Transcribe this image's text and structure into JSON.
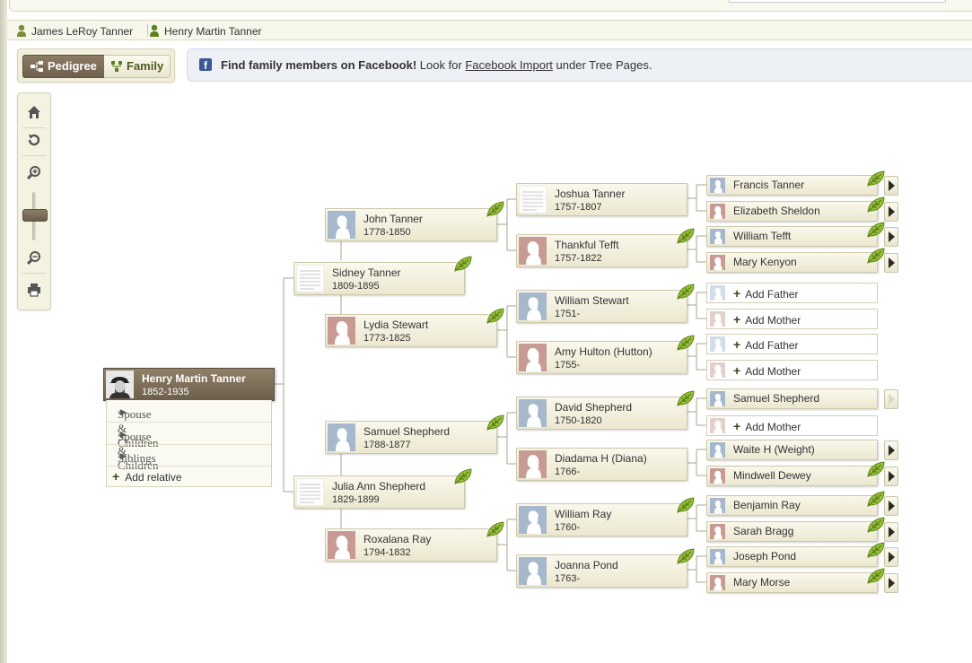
{
  "breadcrumbs": [
    {
      "label": "James LeRoy Tanner"
    },
    {
      "label": "Henry Martin Tanner"
    }
  ],
  "view_toggle": {
    "pedigree": "Pedigree",
    "family": "Family"
  },
  "facebook_bar": {
    "bold": "Find family members on Facebook!",
    "pre": " Look for ",
    "link": "Facebook Import",
    "post": " under Tree Pages."
  },
  "root_person": {
    "name": "Henry Martin Tanner",
    "dates": "1852-1935"
  },
  "root_menu": {
    "item1": "Spouse & Children",
    "item2": "Spouse & Children",
    "item3": "Siblings",
    "add": "Add relative"
  },
  "gen1": {
    "father": {
      "name": "Sidney Tanner",
      "dates": "1809-1895"
    },
    "mother": {
      "name": "Julia Ann Shepherd",
      "dates": "1829-1899"
    }
  },
  "gen2": {
    "ff": {
      "name": "John Tanner",
      "dates": "1778-1850"
    },
    "fm": {
      "name": "Lydia Stewart",
      "dates": "1773-1825"
    },
    "mf": {
      "name": "Samuel Shepherd",
      "dates": "1788-1877"
    },
    "mm": {
      "name": "Roxalana Ray",
      "dates": "1794-1832"
    }
  },
  "gen3": {
    "fff": {
      "name": "Joshua Tanner",
      "dates": "1757-1807"
    },
    "ffm": {
      "name": "Thankful Tefft",
      "dates": "1757-1822"
    },
    "fmf": {
      "name": "William Stewart",
      "dates": "1751-"
    },
    "fmm": {
      "name": "Amy Hulton (Hutton)",
      "dates": "1755-"
    },
    "mff": {
      "name": "David Shepherd",
      "dates": "1750-1820"
    },
    "mfm": {
      "name": "Diadama H (Diana)",
      "dates": "1766-"
    },
    "mmf": {
      "name": "William Ray",
      "dates": "1760-"
    },
    "mmm": {
      "name": "Joanna Pond",
      "dates": "1763-"
    }
  },
  "gen4": {
    "p1": "Francis Tanner",
    "p2": "Elizabeth Sheldon",
    "p3": "William Tefft",
    "p4": "Mary Kenyon",
    "p5": "Add Father",
    "p6": "Add Mother",
    "p7": "Add Father",
    "p8": "Add Mother",
    "p9": "Samuel Shepherd",
    "p10": "Add Mother",
    "p11": "Waite H (Weight)",
    "p12": "Mindwell Dewey",
    "p13": "Benjamin Ray",
    "p14": "Sarah Bragg",
    "p15": "Joseph Pond",
    "p16": "Mary Morse"
  },
  "colors": {
    "male_silhouette": "#9fb4c9",
    "female_silhouette": "#c79a92",
    "root_header": "#7a6b57",
    "leaf": "#8bb52e"
  }
}
